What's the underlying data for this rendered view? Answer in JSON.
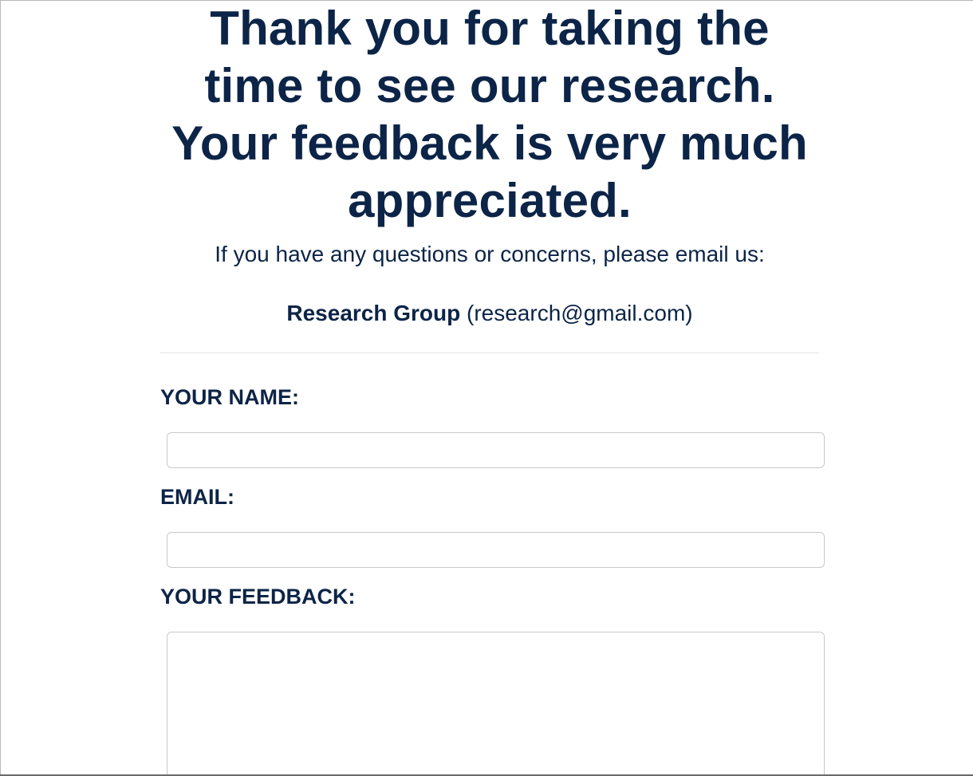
{
  "header": {
    "headline": "Thank you for taking the time to see our research. Your feedback is very much appreciated.",
    "intro": "If you have any questions or concerns, please email us:",
    "contact_name": "Research Group",
    "contact_email": "(research@gmail.com)"
  },
  "form": {
    "name_label": "YOUR NAME:",
    "name_value": "",
    "email_label": "EMAIL:",
    "email_value": "",
    "feedback_label": "YOUR FEEDBACK:",
    "feedback_value": ""
  },
  "colors": {
    "text": "#0c2447",
    "border": "#c9c9c9",
    "divider": "#e6e6e6"
  }
}
